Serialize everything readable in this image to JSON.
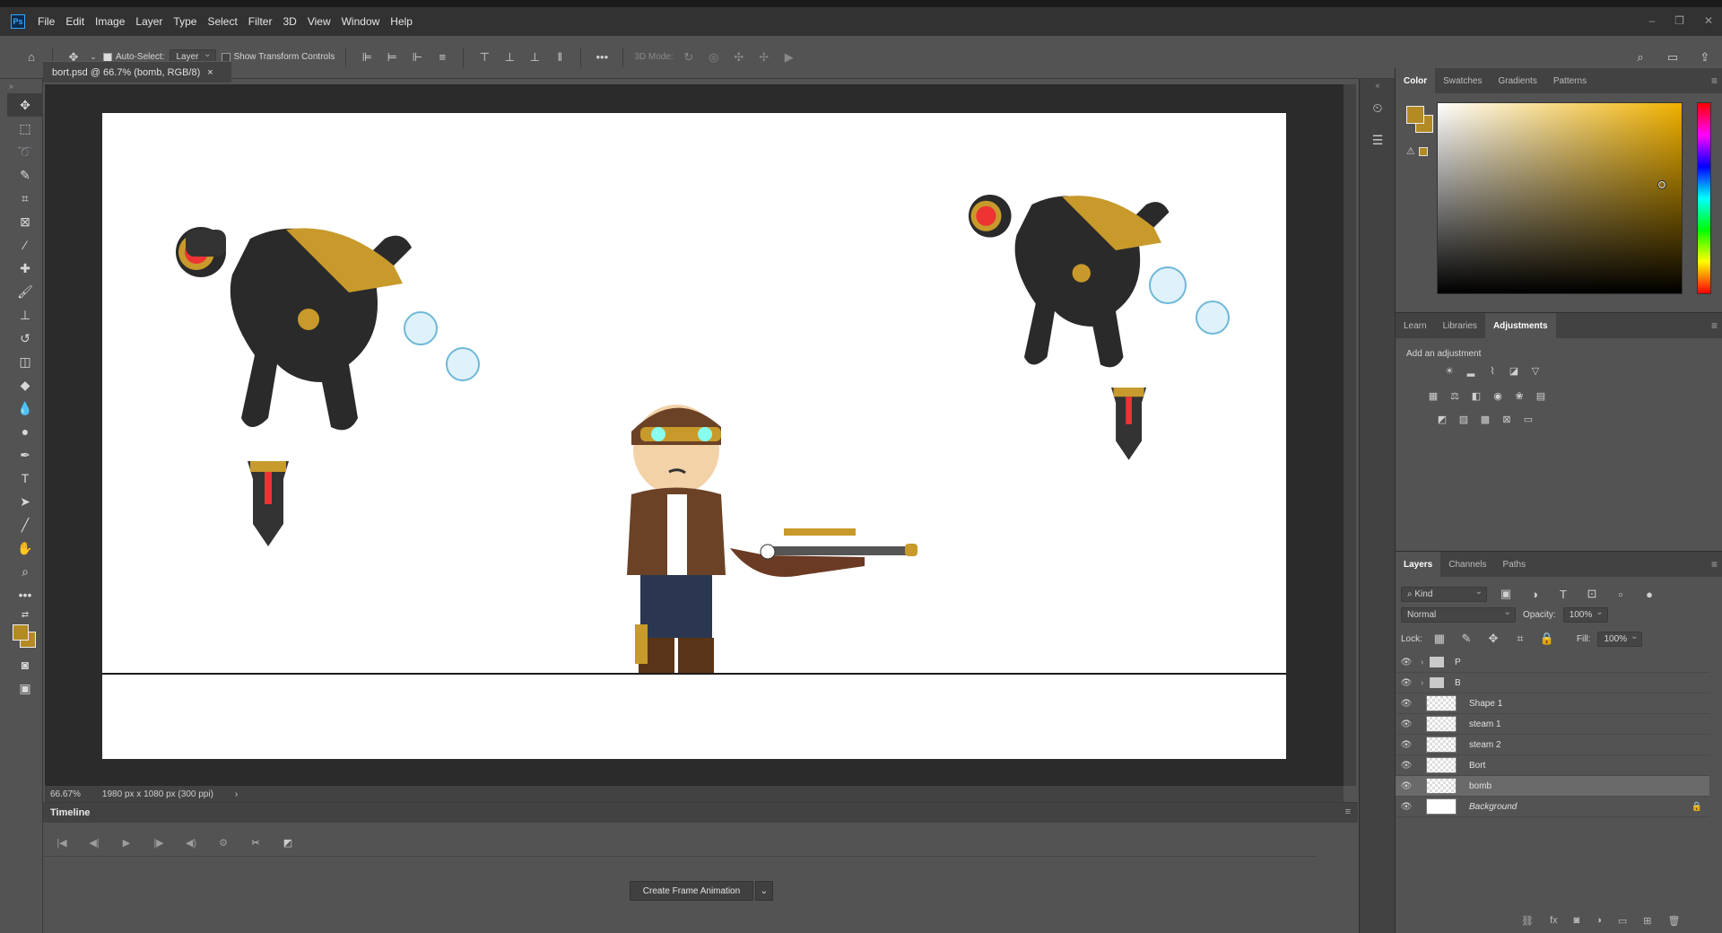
{
  "menu": {
    "app_logo": "Ps",
    "items": [
      "File",
      "Edit",
      "Image",
      "Layer",
      "Type",
      "Select",
      "Filter",
      "3D",
      "View",
      "Window",
      "Help"
    ]
  },
  "options_bar": {
    "auto_select_label": "Auto-Select:",
    "auto_select_checked": true,
    "auto_select_target": "Layer",
    "show_transform_label": "Show Transform Controls",
    "show_transform_checked": false,
    "mode_3d_label": "3D Mode:"
  },
  "document": {
    "tab_title": "bort.psd @ 66.7% (bomb, RGB/8)",
    "tab_close": "×"
  },
  "status": {
    "zoom": "66.67%",
    "doc_info": "1980 px x 1080 px (300 ppi)",
    "arrow": "›"
  },
  "timeline": {
    "title": "Timeline",
    "create_button": "Create Frame Animation"
  },
  "color_panel": {
    "tabs": [
      "Color",
      "Swatches",
      "Gradients",
      "Patterns"
    ],
    "active_tab": "Color",
    "foreground": "#b48a25",
    "background": "#b48a25"
  },
  "adjustments_panel": {
    "tabs": [
      "Learn",
      "Libraries",
      "Adjustments"
    ],
    "active_tab": "Adjustments",
    "label": "Add an adjustment"
  },
  "layers_panel": {
    "tabs": [
      "Layers",
      "Channels",
      "Paths"
    ],
    "active_tab": "Layers",
    "filter_kind": "Kind",
    "blend_mode": "Normal",
    "opacity_label": "Opacity:",
    "opacity_value": "100%",
    "lock_label": "Lock:",
    "fill_label": "Fill:",
    "fill_value": "100%",
    "layers": [
      {
        "name": "P",
        "type": "group"
      },
      {
        "name": "B",
        "type": "group"
      },
      {
        "name": "Shape 1",
        "type": "layer"
      },
      {
        "name": "steam 1",
        "type": "layer"
      },
      {
        "name": "steam 2",
        "type": "layer"
      },
      {
        "name": "Bort",
        "type": "layer"
      },
      {
        "name": "bomb",
        "type": "layer",
        "selected": true
      },
      {
        "name": "Background",
        "type": "background",
        "locked": true
      }
    ]
  },
  "colors": {
    "app_bg": "#535353",
    "panel_dark": "#424242",
    "accent_gold": "#b48a25"
  }
}
